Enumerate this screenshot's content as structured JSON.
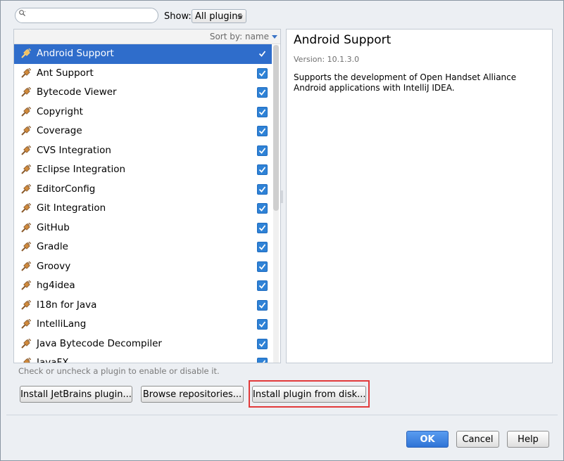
{
  "search": {
    "placeholder": ""
  },
  "show": {
    "label": "Show:",
    "value": "All plugins"
  },
  "sort": {
    "label": "Sort by: name"
  },
  "plugins": [
    {
      "name": "Android Support",
      "checked": true,
      "selected": true
    },
    {
      "name": "Ant Support",
      "checked": true
    },
    {
      "name": "Bytecode Viewer",
      "checked": true
    },
    {
      "name": "Copyright",
      "checked": true
    },
    {
      "name": "Coverage",
      "checked": true
    },
    {
      "name": "CVS Integration",
      "checked": true
    },
    {
      "name": "Eclipse Integration",
      "checked": true
    },
    {
      "name": "EditorConfig",
      "checked": true
    },
    {
      "name": "Git Integration",
      "checked": true
    },
    {
      "name": "GitHub",
      "checked": true
    },
    {
      "name": "Gradle",
      "checked": true
    },
    {
      "name": "Groovy",
      "checked": true
    },
    {
      "name": "hg4idea",
      "checked": true
    },
    {
      "name": "I18n for Java",
      "checked": true
    },
    {
      "name": "IntelliLang",
      "checked": true
    },
    {
      "name": "Java Bytecode Decompiler",
      "checked": true
    },
    {
      "name": "JavaFX",
      "checked": true
    }
  ],
  "details": {
    "title": "Android Support",
    "version": "Version: 10.1.3.0",
    "description": "Supports the development of Open Handset Alliance Android applications with IntelliJ IDEA."
  },
  "hint": "Check or uncheck a plugin to enable or disable it.",
  "buttons": {
    "install_jetbrains": "Install JetBrains plugin...",
    "browse": "Browse repositories...",
    "install_disk": "Install plugin from disk...",
    "ok": "OK",
    "cancel": "Cancel",
    "help": "Help"
  },
  "colors": {
    "selection": "#2f6dcb",
    "highlight_box": "#e23a3a",
    "checkbox": "#2f82d6"
  }
}
